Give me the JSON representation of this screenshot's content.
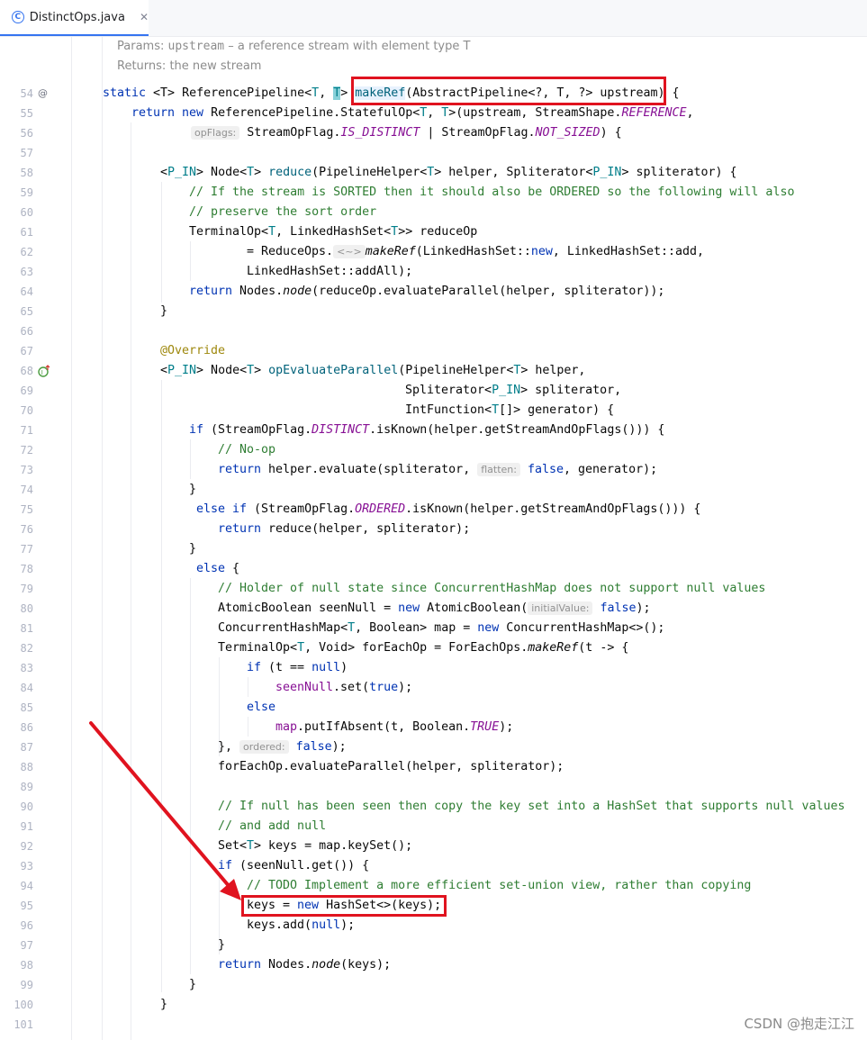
{
  "tab": {
    "icon": "class-icon",
    "icon_glyph": "C",
    "filename": "DistinctOps.java",
    "close": "✕"
  },
  "doc": {
    "params_label": "Params:",
    "params_name": "upstream",
    "params_desc": " – a reference stream with element type T",
    "returns_label": "Returns:",
    "returns_desc": "the new stream"
  },
  "line_numbers": [
    "54",
    "55",
    "56",
    "57",
    "58",
    "59",
    "60",
    "61",
    "62",
    "63",
    "64",
    "65",
    "66",
    "67",
    "68",
    "69",
    "70",
    "71",
    "72",
    "73",
    "74",
    "75",
    "76",
    "77",
    "78",
    "79",
    "80",
    "81",
    "82",
    "83",
    "84",
    "85",
    "86",
    "87",
    "88",
    "89",
    "90",
    "91",
    "92",
    "93",
    "94",
    "95",
    "96",
    "97",
    "98",
    "99",
    "100",
    "101"
  ],
  "gutter_icons": {
    "line54": "@",
    "line68": "override-icon"
  },
  "code": {
    "l54": [
      "static ",
      "<T> ReferencePipeline<",
      "T",
      ", ",
      "T",
      "> ",
      "makeRef",
      "(AbstractPipeline<?, T, ?> upstream) {"
    ],
    "l55": [
      "return ",
      "new ",
      "ReferencePipeline.StatefulOp<",
      "T",
      ", ",
      "T",
      ">(upstream, StreamShape.",
      "REFERENCE",
      ","
    ],
    "l56": [
      "opFlags:",
      " StreamOpFlag.",
      "IS_DISTINCT",
      " | StreamOpFlag.",
      "NOT_SIZED",
      ") {"
    ],
    "l58": [
      "<",
      "P_IN",
      "> Node<",
      "T",
      "> ",
      "reduce",
      "(PipelineHelper<",
      "T",
      "> helper, Spliterator<",
      "P_IN",
      "> spliterator) {"
    ],
    "l59": "// If the stream is SORTED then it should also be ORDERED so the following will also",
    "l60": "// preserve the sort order",
    "l61": [
      "TerminalOp<",
      "T",
      ", LinkedHashSet<",
      "T",
      ">> reduceOp"
    ],
    "l62": [
      "= ReduceOps.",
      "<~>",
      "makeRef",
      "(LinkedHashSet::",
      "new",
      ", LinkedHashSet::add,"
    ],
    "l63": "LinkedHashSet::addAll);",
    "l64": [
      "return ",
      "Nodes.",
      "node",
      "(reduceOp.evaluateParallel(helper, spliterator));"
    ],
    "l65": "}",
    "l67": "@Override",
    "l68": [
      "<",
      "P_IN",
      "> Node<",
      "T",
      "> ",
      "opEvaluateParallel",
      "(PipelineHelper<",
      "T",
      "> helper,"
    ],
    "l69": [
      "Spliterator<",
      "P_IN",
      "> spliterator,"
    ],
    "l70": [
      "IntFunction<",
      "T",
      "[]> generator) {"
    ],
    "l71": [
      "if ",
      "(StreamOpFlag.",
      "DISTINCT",
      ".isKnown(helper.getStreamAndOpFlags())) {"
    ],
    "l72": "// No-op",
    "l73": [
      "return ",
      "helper.evaluate(spliterator, ",
      "flatten:",
      " ",
      "false",
      ", generator);"
    ],
    "l74": "}",
    "l75": [
      "else if ",
      "(StreamOpFlag.",
      "ORDERED",
      ".isKnown(helper.getStreamAndOpFlags())) {"
    ],
    "l76": [
      "return ",
      "reduce(helper, spliterator);"
    ],
    "l77": "}",
    "l78": [
      "else ",
      "{"
    ],
    "l79": "// Holder of null state since ConcurrentHashMap does not support null values",
    "l80": [
      "AtomicBoolean seenNull = ",
      "new ",
      "AtomicBoolean(",
      "initialValue:",
      " ",
      "false",
      ");"
    ],
    "l81": [
      "ConcurrentHashMap<",
      "T",
      ", Boolean> map = ",
      "new ",
      "ConcurrentHashMap<>();"
    ],
    "l82": [
      "TerminalOp<",
      "T",
      ", Void> forEachOp = ForEachOps.",
      "makeRef",
      "(t -> {"
    ],
    "l83": [
      "if ",
      "(t == ",
      "null",
      ")"
    ],
    "l84": [
      "seenNull",
      ".set(",
      "true",
      ");"
    ],
    "l85": "else",
    "l86": [
      "map",
      ".putIfAbsent(t, Boolean.",
      "TRUE",
      ");"
    ],
    "l87": [
      "}, ",
      "ordered:",
      " ",
      "false",
      ");"
    ],
    "l88": "forEachOp.evaluateParallel(helper, spliterator);",
    "l90": "// If null has been seen then copy the key set into a HashSet that supports null values",
    "l91": "// and add null",
    "l92": [
      "Set<",
      "T",
      "> keys = map.keySet();"
    ],
    "l93": [
      "if ",
      "(seenNull.get()) {"
    ],
    "l94": "// TODO Implement a more efficient set-union view, rather than copying",
    "l95": [
      "keys = ",
      "new ",
      "HashSet<>(keys);"
    ],
    "l96": [
      "keys.add(",
      "null",
      ");"
    ],
    "l97": "}",
    "l98": [
      "return ",
      "Nodes.",
      "node",
      "(keys);"
    ],
    "l99": "}",
    "l100": "}"
  },
  "watermark": "CSDN @抱走江江",
  "colors": {
    "keyword": "#0033b3",
    "comment": "#8c8c8c",
    "highlight_box": "#e0131f",
    "arrow": "#e0131f"
  }
}
